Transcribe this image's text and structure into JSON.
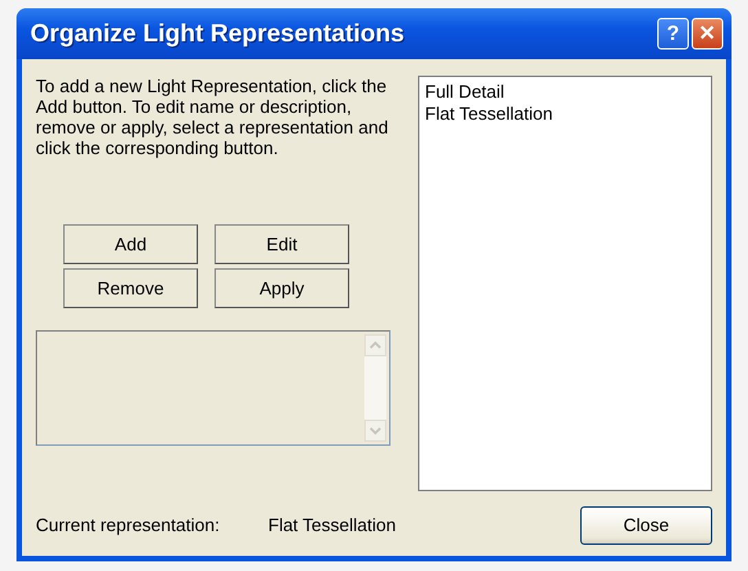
{
  "window": {
    "title": "Organize Light Representations",
    "title_buttons": [
      {
        "kind": "help",
        "label": "?"
      },
      {
        "kind": "close",
        "label": "✕"
      }
    ]
  },
  "instructions": "To add a new Light Representation, click the Add button. To edit name or description, remove or apply, select a representation and click the corresponding button.",
  "buttons": [
    {
      "label": "Add"
    },
    {
      "label": "Edit"
    },
    {
      "label": "Remove"
    },
    {
      "label": "Apply"
    }
  ],
  "description_box": {
    "disabled": true
  },
  "representations": [
    {
      "label": "Full Detail",
      "selected": false
    },
    {
      "label": "Flat Tessellation",
      "selected": false
    }
  ],
  "current": {
    "label": "Current representation:",
    "value": "Flat Tessellation"
  },
  "close_button": "Close"
}
